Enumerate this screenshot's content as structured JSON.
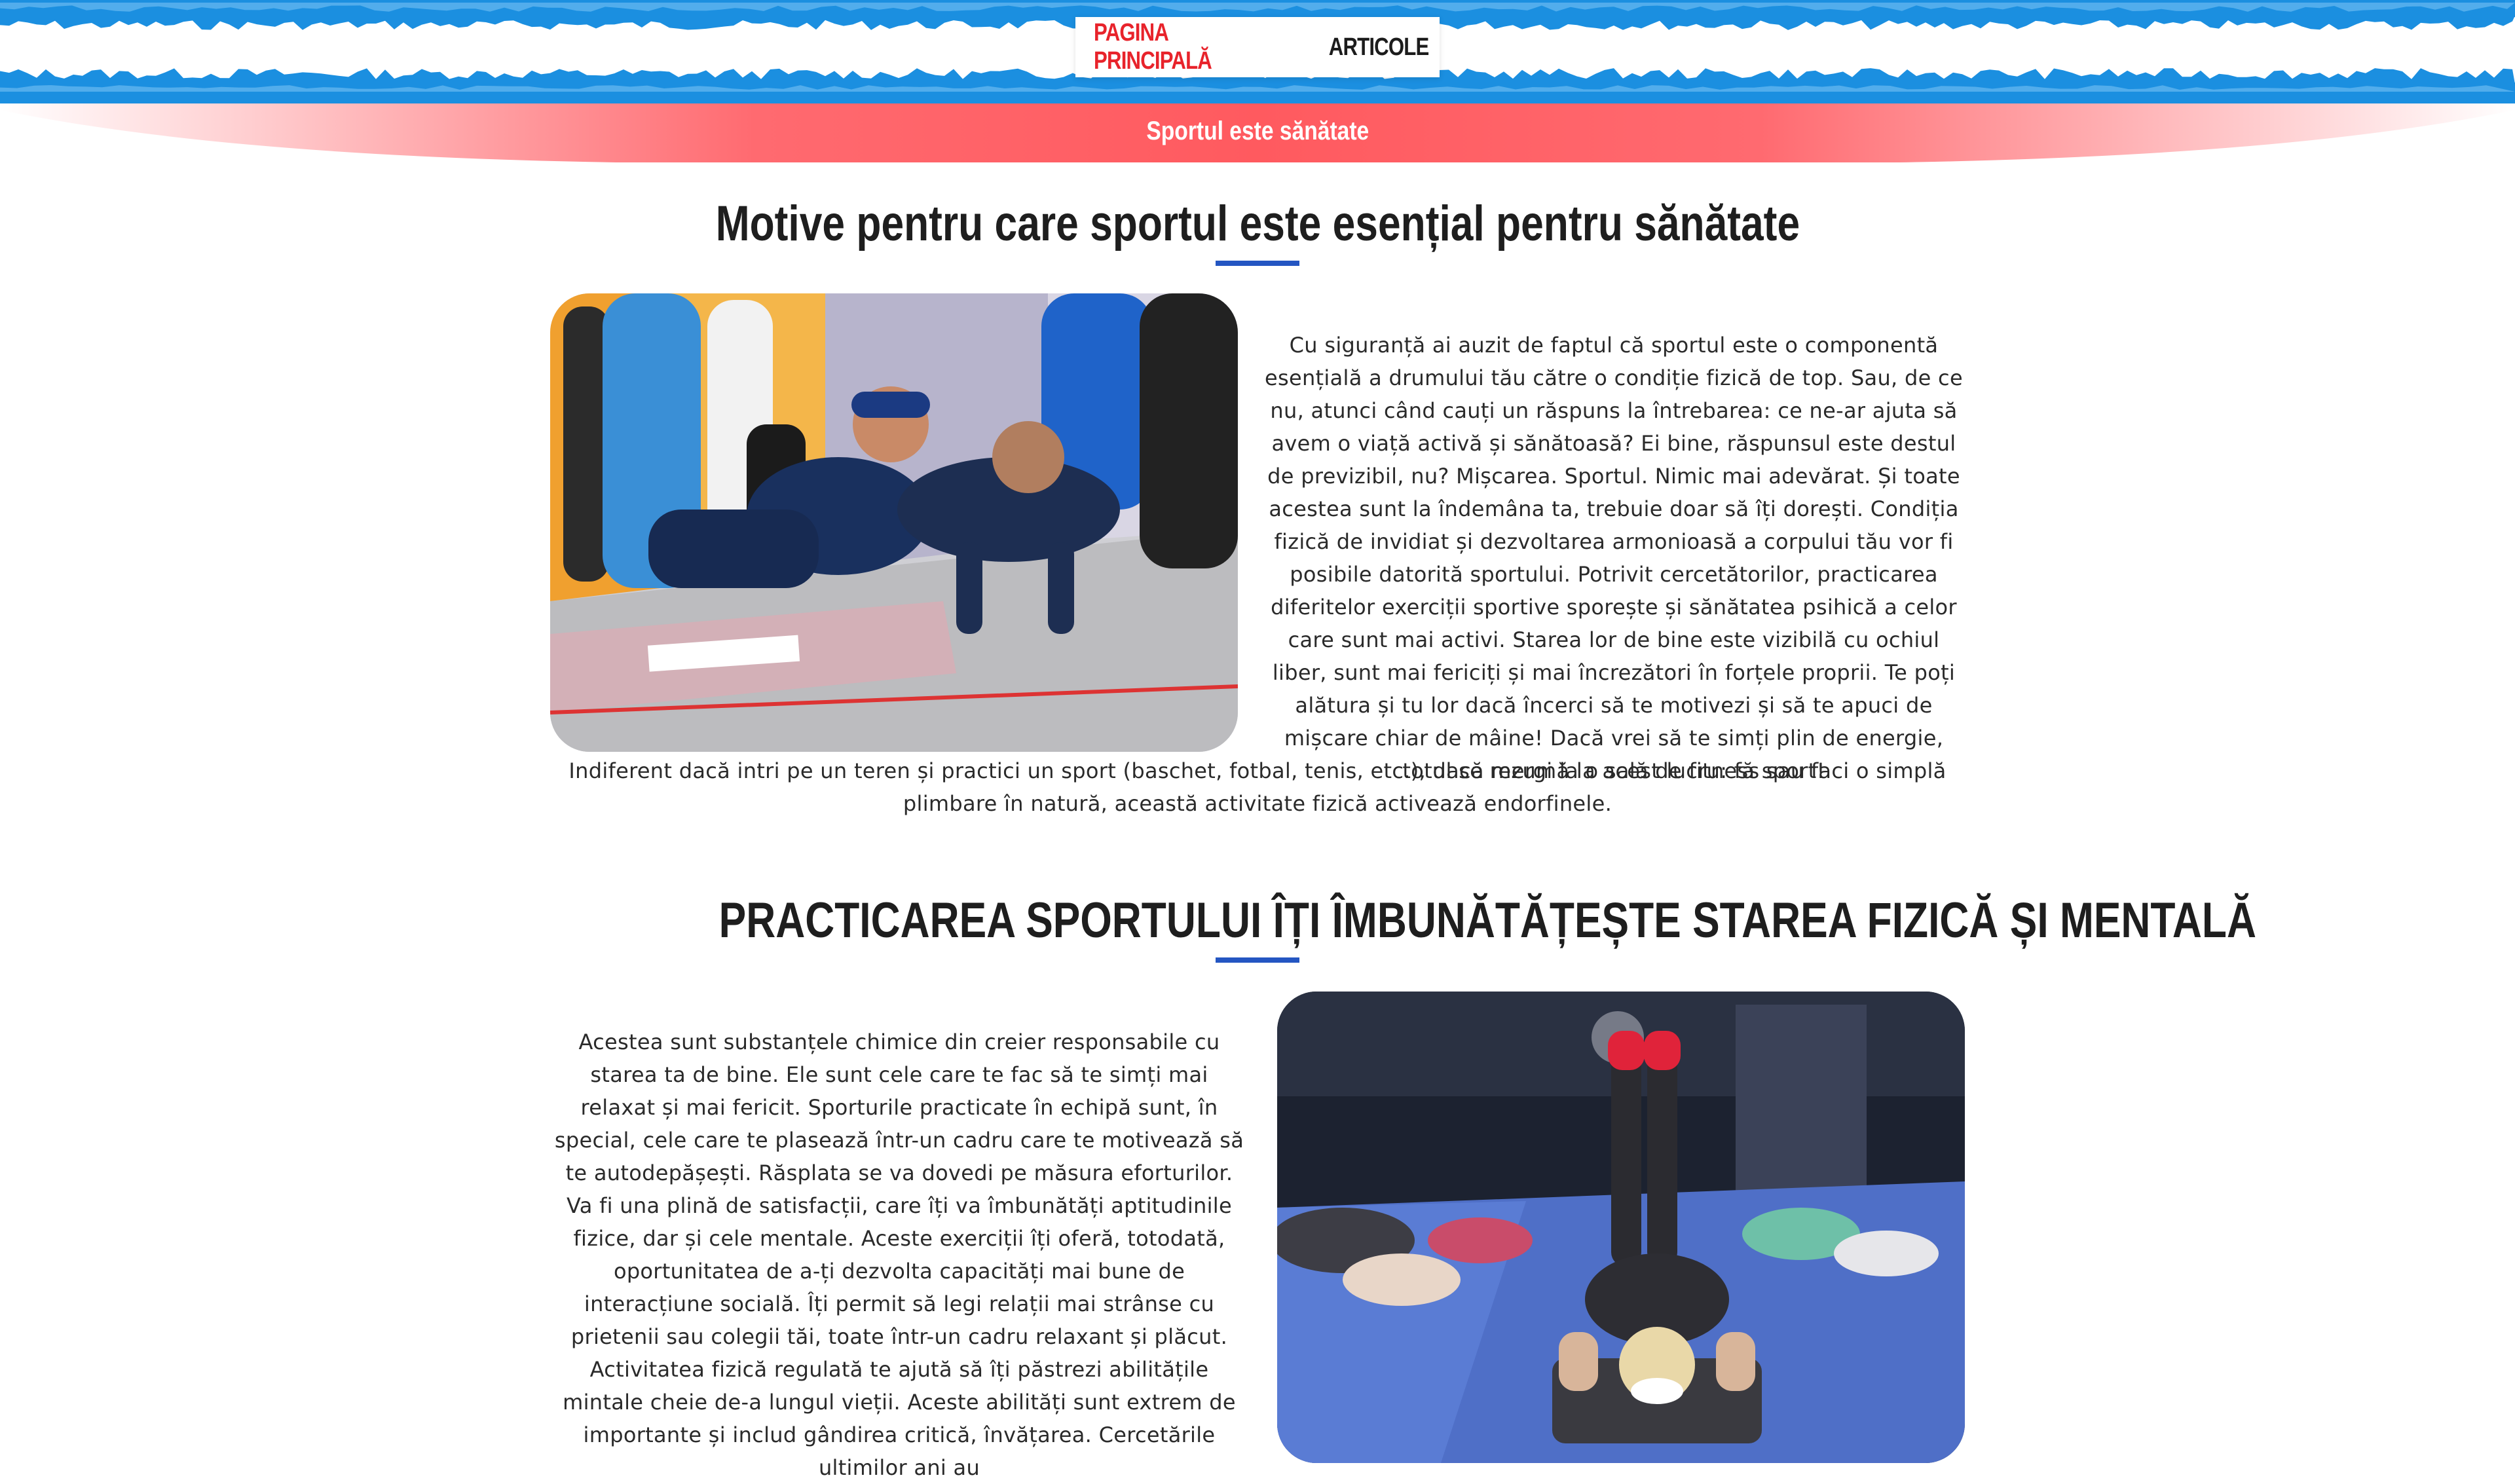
{
  "nav": {
    "items": [
      {
        "label": "PAGINA PRINCIPALĂ",
        "active": true
      },
      {
        "label": "ARTICOLE",
        "active": false
      }
    ]
  },
  "ribbon": {
    "text": "Sportul este sănătate"
  },
  "colors": {
    "accent_red": "#e8232b",
    "accent_blue": "#2456c2",
    "ribbon_red": "#ff5a5f",
    "brush_blue": "#1b8fe0"
  },
  "sections": [
    {
      "title": "Motive pentru care sportul este esențial pentru sănătate",
      "image_alt": "Doi bărbați fac flotări într-o sală de fitness cu perete de escaladă",
      "text_beside": "Cu siguranță ai auzit de faptul că sportul este o componentă esențială a drumului tău către o condiție fizică de top. Sau, de ce nu, atunci când cauți un răspuns la întrebarea: ce ne-ar ajuta să avem o viață activă și sănătoasă? Ei bine, răspunsul este destul de previzibil, nu? Mișcarea. Sportul. Nimic mai adevărat. Și toate acestea sunt la îndemâna ta, trebuie doar să îți dorești. Condiția fizică de invidiat și dezvoltarea armonioasă a corpului tău vor fi posibile datorită sportului. Potrivit cercetătorilor, practicarea diferitelor exerciții sportive sporește și sănătatea psihică a celor care sunt mai activi. Starea lor de bine este vizibilă cu ochiul liber, sunt mai fericiți și mai încrezători în forțele proprii. Te poți alătura și tu lor dacă încerci să te motivezi și să te apuci de mișcare chiar de mâine! Dacă vrei să te simți plin de energie, totul se rezumă la acest lucru: fă sport!",
      "text_below": "Indiferent dacă intri pe un teren și practici un sport (baschet, fotbal, tenis, etc.), dacă mergi la o sală de fitness sau faci o simplă plimbare în natură, această activitate fizică activează endorfinele."
    },
    {
      "title": "PRACTICAREA SPORTULUI ÎȚI ÎMBUNĂTĂȚEȘTE STAREA FIZICĂ ȘI MENTALĂ",
      "image_alt": "Persoane care fac abdomene pe saltele într-o sală de fitness",
      "text_beside": "Acestea sunt substanțele chimice din creier responsabile cu starea ta de bine. Ele sunt cele care te fac să te simți mai relaxat și mai fericit. Sporturile practicate în echipă sunt, în special, cele care te plasează într-un cadru care te motivează să te autodepășești. Răsplata se va dovedi pe măsura eforturilor. Va fi una plină de satisfacții, care îți va îmbunătăți aptitudinile fizice, dar și cele mentale. Aceste exerciții îți oferă, totodată, oportunitatea de a-ți dezvolta capacități mai bune de interacțiune socială. Îți permit să legi relații mai strânse cu prietenii sau colegii tăi, toate într-un cadru relaxant și plăcut. Activitatea fizică regulată te ajută să îți păstrezi abilitățile mintale cheie de-a lungul vieții. Aceste abilități sunt extrem de importante și includ gândirea critică, învățarea. Cercetările ultimilor ani au"
    }
  ]
}
